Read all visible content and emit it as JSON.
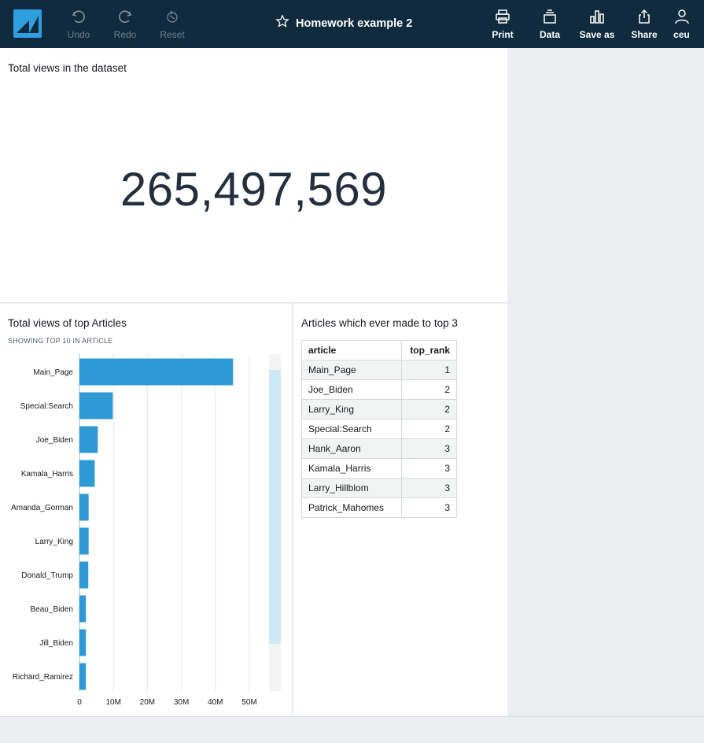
{
  "topbar": {
    "title": "Homework example 2",
    "undo_label": "Undo",
    "redo_label": "Redo",
    "reset_label": "Reset",
    "print_label": "Print",
    "data_label": "Data",
    "saveas_label": "Save as",
    "share_label": "Share",
    "user_label": "ceu"
  },
  "kpi": {
    "title": "Total views in the dataset",
    "value": "265,497,569"
  },
  "bar_panel": {
    "title": "Total views of top Articles",
    "subtitle": "SHOWING TOP 10 IN ARTICLE"
  },
  "chart_data": {
    "type": "bar",
    "orientation": "horizontal",
    "categories": [
      "Main_Page",
      "Special:Search",
      "Joe_Biden",
      "Kamala_Harris",
      "Amanda_Gorman",
      "Larry_King",
      "Donald_Trump",
      "Beau_Biden",
      "Jill_Biden",
      "Richard_Ramirez"
    ],
    "values": [
      45200000,
      9800000,
      5400000,
      4500000,
      2700000,
      2700000,
      2600000,
      1900000,
      1900000,
      1900000
    ],
    "xlim": [
      0,
      50000000
    ],
    "xticks": [
      "0",
      "10M",
      "20M",
      "30M",
      "40M",
      "50M"
    ],
    "grid": true,
    "color": "#2d9ad6"
  },
  "table_panel": {
    "title": "Articles which ever made to top 3",
    "headers": [
      "article",
      "top_rank"
    ],
    "rows": [
      [
        "Main_Page",
        "1"
      ],
      [
        "Joe_Biden",
        "2"
      ],
      [
        "Larry_King",
        "2"
      ],
      [
        "Special:Search",
        "2"
      ],
      [
        "Hank_Aaron",
        "3"
      ],
      [
        "Kamala_Harris",
        "3"
      ],
      [
        "Larry_Hillblom",
        "3"
      ],
      [
        "Patrick_Mahomes",
        "3"
      ]
    ]
  }
}
